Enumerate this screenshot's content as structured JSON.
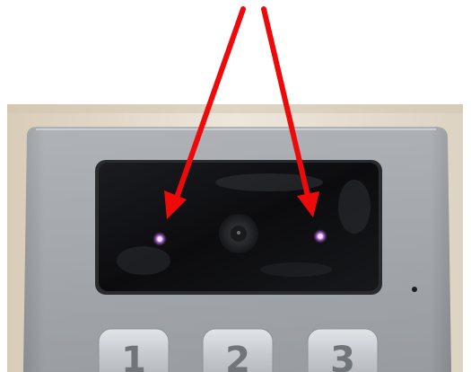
{
  "photo": {
    "subject": "intercom-panel-photo",
    "keypad_keys": [
      "1",
      "2",
      "3"
    ]
  },
  "colors": {
    "background": "#ffffff",
    "wall": "#e6dccd",
    "panel": "#a5a9ad",
    "glass": "#0e0e11",
    "arrow": "#ee0a0a",
    "ir_led": "#d77cff",
    "key": "#c8ccd0"
  },
  "icons": {
    "left_arrow": "red-arrow-icon",
    "right_arrow": "red-arrow-icon"
  }
}
